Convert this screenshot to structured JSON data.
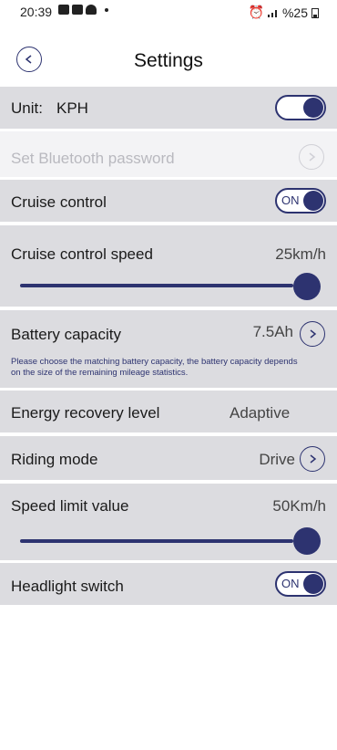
{
  "status": {
    "time": "20:39",
    "battery": "%25"
  },
  "header": {
    "title": "Settings"
  },
  "unit": {
    "label": "Unit:",
    "value": "KPH",
    "toggle_on": true
  },
  "bluetooth": {
    "label": "Set Bluetooth password"
  },
  "cruise": {
    "label": "Cruise control",
    "toggle_text": "ON"
  },
  "cruise_speed": {
    "label": "Cruise control speed",
    "value": "25km/h",
    "level": 1.0
  },
  "battery": {
    "label": "Battery capacity",
    "value": "7.5Ah",
    "note": "Please choose the matching battery capacity, the battery capacity depends on the size of the remaining mileage statistics."
  },
  "energy": {
    "label": "Energy recovery level",
    "value": "Adaptive"
  },
  "riding": {
    "label": "Riding mode",
    "value": "Drive"
  },
  "speed_limit": {
    "label": "Speed limit value",
    "value": "50Km/h",
    "level": 1.0
  },
  "headlight": {
    "label": "Headlight switch",
    "toggle_text": "ON"
  },
  "colors": {
    "accent": "#2d3370",
    "row_bg": "#dcdce0",
    "disabled_bg": "#f3f3f5"
  }
}
